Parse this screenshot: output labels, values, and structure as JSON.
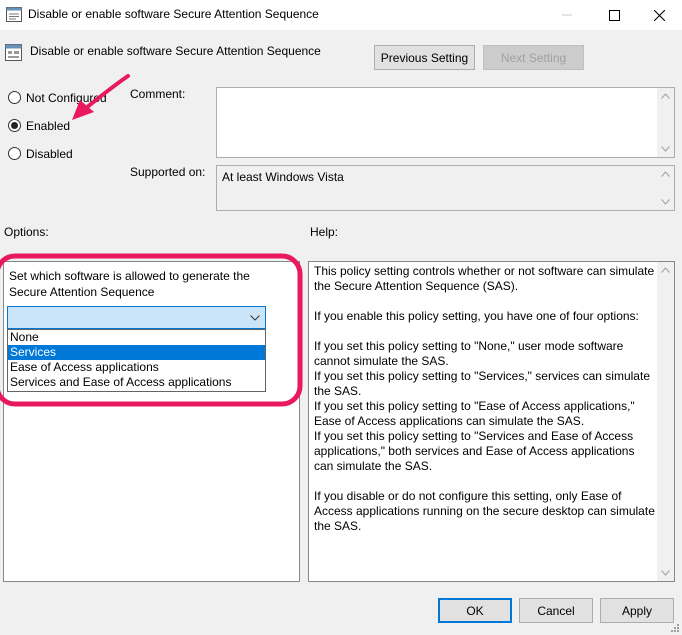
{
  "window": {
    "title": "Disable or enable software Secure Attention Sequence"
  },
  "header": {
    "policy_title": "Disable or enable software Secure Attention Sequence",
    "previous_label": "Previous Setting",
    "next_label": "Next Setting"
  },
  "state": {
    "options": [
      {
        "label": "Not Configured",
        "checked": false
      },
      {
        "label": "Enabled",
        "checked": true
      },
      {
        "label": "Disabled",
        "checked": false
      }
    ]
  },
  "comment": {
    "label": "Comment:",
    "value": ""
  },
  "supported": {
    "label": "Supported on:",
    "value": "At least Windows Vista"
  },
  "options_panel": {
    "label": "Options:",
    "description": "Set which software is allowed to generate the Secure Attention Sequence",
    "dropdown": {
      "value": "",
      "items": [
        "None",
        "Services",
        "Ease of Access applications",
        "Services and Ease of Access applications"
      ],
      "selected_index": 1
    }
  },
  "help_panel": {
    "label": "Help:",
    "paragraphs": [
      "This policy setting controls whether or not software can simulate the Secure Attention Sequence (SAS).",
      "If you enable this policy setting, you have one of four options:"
    ],
    "option_lines": [
      "If you set this policy setting to \"None,\" user mode software cannot simulate the SAS.",
      "If you set this policy setting to \"Services,\" services can simulate the SAS.",
      "If you set this policy setting to \"Ease of Access applications,\" Ease of Access applications can simulate the SAS.",
      "If you set this policy setting to \"Services and Ease of Access applications,\" both services and Ease of Access applications can simulate the SAS."
    ],
    "closing": "If you disable or do not configure this setting, only Ease of Access applications running on the secure desktop can simulate the SAS."
  },
  "footer": {
    "ok_label": "OK",
    "cancel_label": "Cancel",
    "apply_label": "Apply"
  },
  "colors": {
    "annotation": "#e8195f",
    "selection": "#0078d7",
    "window_bg": "#f0f0f0"
  }
}
